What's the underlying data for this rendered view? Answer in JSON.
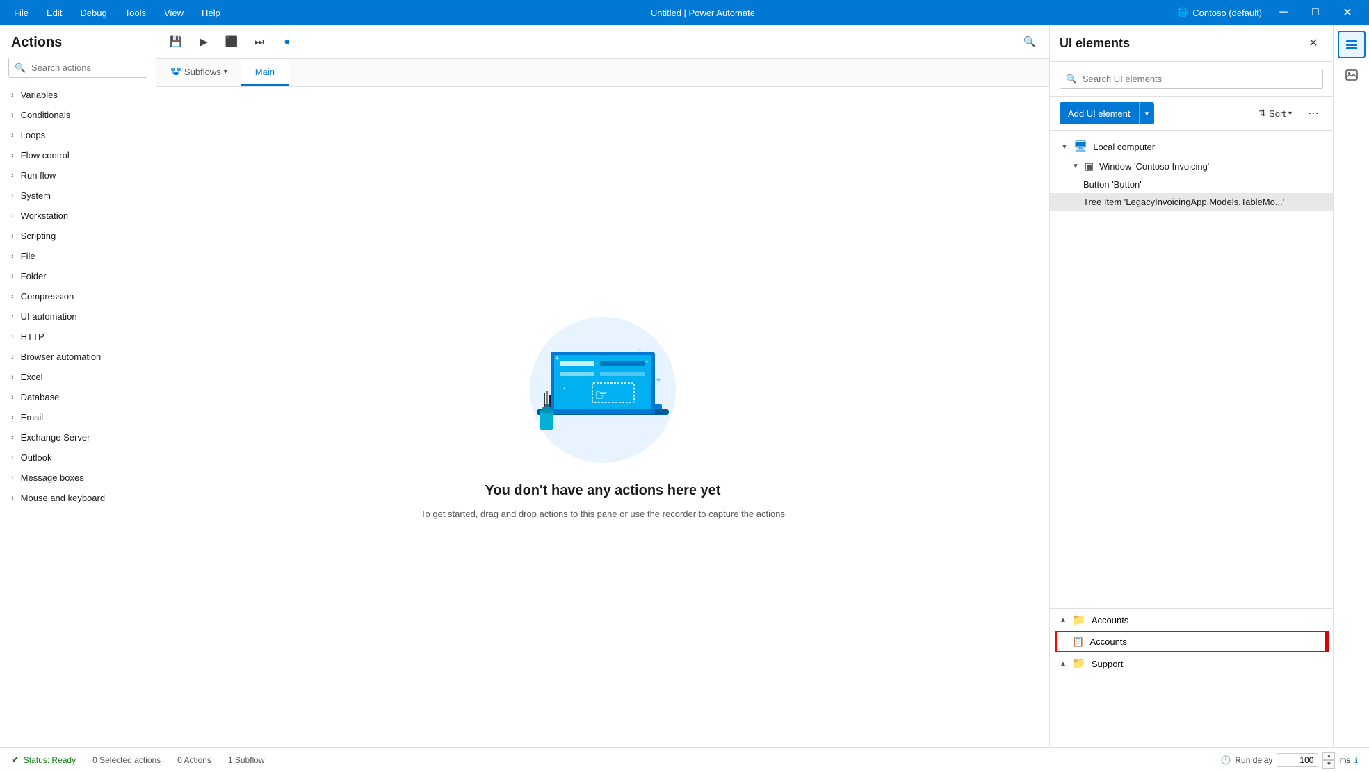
{
  "titleBar": {
    "menus": [
      "File",
      "Edit",
      "Debug",
      "Tools",
      "View",
      "Help"
    ],
    "title": "Untitled | Power Automate",
    "account": "Contoso (default)",
    "controls": [
      "─",
      "□",
      "✕"
    ]
  },
  "actionsPanel": {
    "title": "Actions",
    "searchPlaceholder": "Search actions",
    "items": [
      "Variables",
      "Conditionals",
      "Loops",
      "Flow control",
      "Run flow",
      "System",
      "Workstation",
      "Scripting",
      "File",
      "Folder",
      "Compression",
      "UI automation",
      "HTTP",
      "Browser automation",
      "Excel",
      "Database",
      "Email",
      "Exchange Server",
      "Outlook",
      "Message boxes",
      "Mouse and keyboard"
    ]
  },
  "toolbar": {
    "buttons": [
      "💾",
      "▶",
      "⬛",
      "⏭",
      "⏺"
    ]
  },
  "tabs": {
    "subflows": "Subflows",
    "main": "Main"
  },
  "emptyState": {
    "title": "You don't have any actions here yet",
    "subtitle": "To get started, drag and drop actions to this pane\nor use the recorder to capture the actions"
  },
  "uiPanel": {
    "title": "UI elements",
    "searchPlaceholder": "Search UI elements",
    "addButton": "Add UI element",
    "sortLabel": "Sort",
    "tree": [
      {
        "level": 0,
        "icon": "🖥",
        "label": "Local computer",
        "collapsed": false,
        "chevron": "▼"
      },
      {
        "level": 1,
        "icon": "⬛",
        "label": "Window 'Contoso Invoicing'",
        "collapsed": false,
        "chevron": "▼"
      },
      {
        "level": 2,
        "icon": "",
        "label": "Button 'Button'",
        "chevron": ""
      },
      {
        "level": 2,
        "icon": "",
        "label": "Tree Item 'LegacyInvoicingApp.Models.TableMo...'",
        "chevron": "",
        "selected": true
      }
    ]
  },
  "accountsSection": {
    "items": [
      {
        "level": 0,
        "label": "Accounts",
        "icon": "📁",
        "chevron": "▲"
      },
      {
        "level": 1,
        "label": "Accounts",
        "icon": "📋",
        "selected": true
      },
      {
        "level": 0,
        "label": "Support",
        "icon": "📁",
        "chevron": "▲"
      }
    ]
  },
  "statusBar": {
    "ready": "Status: Ready",
    "selectedActions": "0 Selected actions",
    "actions": "0 Actions",
    "subflow": "1 Subflow",
    "runDelay": "Run delay",
    "delayValue": "100",
    "delayUnit": "ms"
  },
  "iconSidebar": [
    {
      "icon": "⊞",
      "name": "layers-icon",
      "active": true
    },
    {
      "icon": "🖼",
      "name": "image-icon",
      "active": false
    }
  ]
}
